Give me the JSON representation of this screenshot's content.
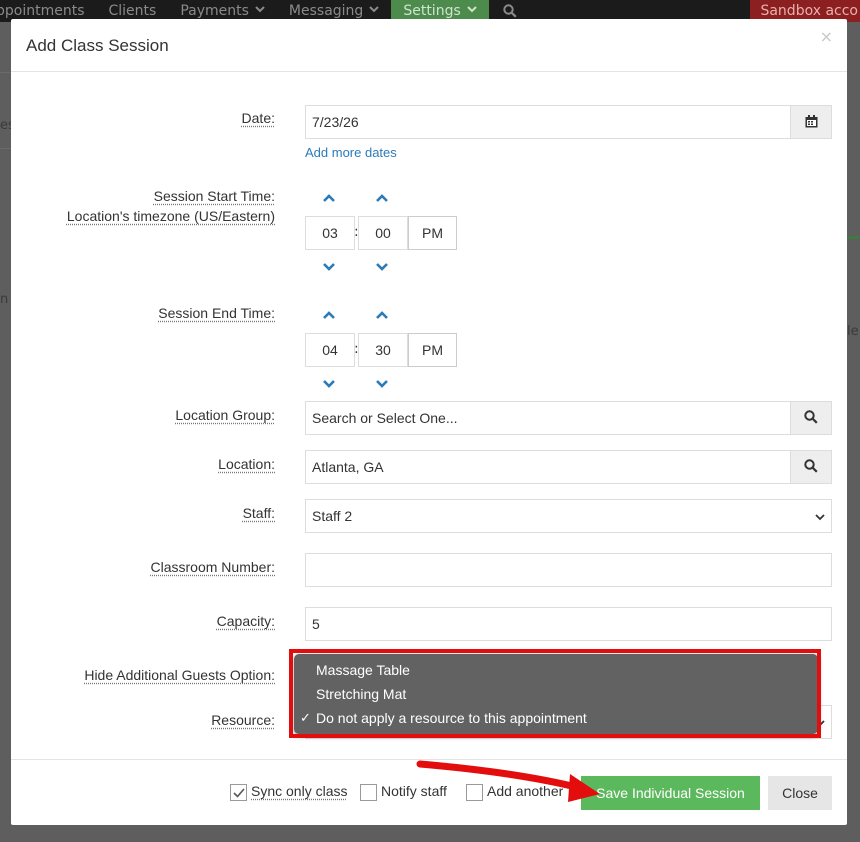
{
  "navbar": {
    "items": [
      {
        "label": "ppointments",
        "chevron": false
      },
      {
        "label": "Clients",
        "chevron": false
      },
      {
        "label": "Payments",
        "chevron": true
      },
      {
        "label": "Messaging",
        "chevron": true
      },
      {
        "label": "Settings",
        "chevron": true
      }
    ],
    "sandbox_label": "Sandbox acco"
  },
  "background": {
    "frag_es": "es",
    "frag_n": "n",
    "frag_e": "le"
  },
  "modal": {
    "title": "Add Class Session",
    "close_glyph": "×",
    "date": {
      "label": "Date:",
      "value": "7/23/26",
      "add_more_link": "Add more dates"
    },
    "start_time": {
      "label": "Session Start Time:",
      "timezone_label": "Location's timezone (US/Eastern)",
      "hour": "03",
      "minute": "00",
      "separator": ":",
      "meridiem": "PM"
    },
    "end_time": {
      "label": "Session End Time:",
      "hour": "04",
      "minute": "30",
      "separator": ":",
      "meridiem": "PM"
    },
    "location_group": {
      "label": "Location Group:",
      "placeholder": "Search or Select One..."
    },
    "location": {
      "label": "Location:",
      "value": "Atlanta, GA"
    },
    "staff": {
      "label": "Staff:",
      "value": "Staff 2"
    },
    "classroom": {
      "label": "Classroom Number:",
      "value": ""
    },
    "capacity": {
      "label": "Capacity:",
      "value": "5"
    },
    "hide_guests": {
      "label": "Hide Additional Guests Option:"
    },
    "resource": {
      "label": "Resource:",
      "options": [
        {
          "label": "Massage Table",
          "selected": false
        },
        {
          "label": "Stretching Mat",
          "selected": false
        },
        {
          "label": "Do not apply a resource to this appointment",
          "selected": true
        }
      ],
      "check_glyph": "✓"
    },
    "footer": {
      "sync_only_class": {
        "label": "Sync only class",
        "checked": true
      },
      "notify_staff": {
        "label": "Notify staff",
        "checked": false
      },
      "add_another": {
        "label": "Add another",
        "checked": false
      },
      "save_button": "Save Individual Session",
      "close_button": "Close"
    }
  },
  "colors": {
    "accent_link": "#2b7bb9",
    "save_green": "#5cb85c",
    "highlight_red": "#e30d0d",
    "annotation_arrow": "#e30d0d"
  }
}
